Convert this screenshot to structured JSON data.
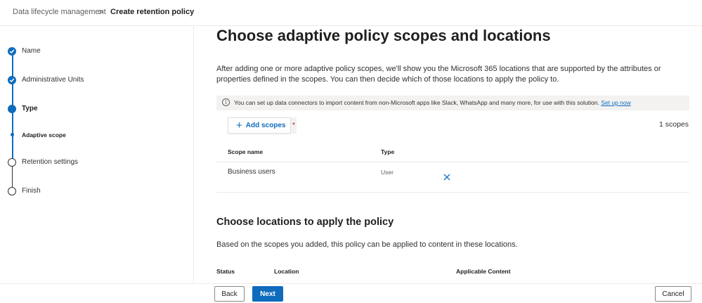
{
  "breadcrumb": {
    "items": [
      "Data lifecycle management",
      "Create retention policy"
    ],
    "separator": ">"
  },
  "steps": [
    {
      "label": "Name",
      "state": "done"
    },
    {
      "label": "Administrative Units",
      "state": "done"
    },
    {
      "label": "Type",
      "state": "current"
    },
    {
      "label": "Adaptive scope",
      "state": "current-sub"
    },
    {
      "label": "Retention settings",
      "state": "future"
    },
    {
      "label": "Finish",
      "state": "future"
    }
  ],
  "main": {
    "title": "Choose adaptive policy scopes and locations",
    "intro": "After adding one or more adaptive policy scopes, we'll show you the Microsoft 365 locations that are supported by the attributes or properties defined in the scopes. You can then decide which of those locations to apply the policy to.",
    "info": {
      "icon": "info-icon",
      "icon_glyph": "i",
      "text": "You can set up data connectors to import content from non-Microsoft apps like Slack, WhatsApp and many more, for use with this solution.",
      "link": "Set up now"
    },
    "add_scopes": {
      "icon": "plus-icon",
      "glyph": "+",
      "label": "Add scopes",
      "required_mark": "*"
    },
    "scope_count": "1 scopes",
    "scopes_table": {
      "headers": [
        "Scope name",
        "Type"
      ],
      "rows": [
        {
          "name": "Business users",
          "type": "User",
          "remove_icon": "close-icon"
        }
      ]
    },
    "locations": {
      "title": "Choose locations to apply the policy",
      "subtitle": "Based on the scopes you added, this policy can be applied to content in these locations.",
      "headers": [
        "Status",
        "Location",
        "Applicable Content"
      ]
    }
  },
  "footer": {
    "back": "Back",
    "next": "Next",
    "cancel": "Cancel"
  },
  "colors": {
    "accent": "#0f6cbd",
    "required": "#a4262c"
  }
}
